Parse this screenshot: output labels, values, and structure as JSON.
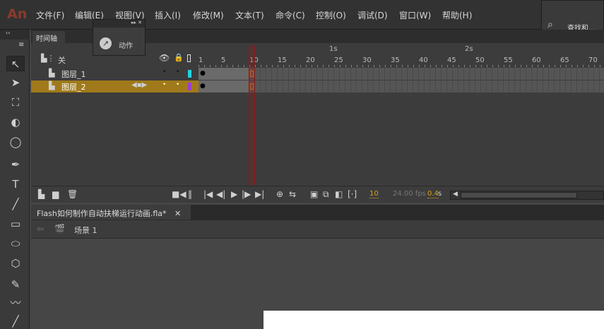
{
  "app": {
    "logo": "An"
  },
  "menu": [
    "文件(F)",
    "编辑(E)",
    "视图(V)",
    "插入(I)",
    "修改(M)",
    "文本(T)",
    "命令(C)",
    "控制(O)",
    "调试(D)",
    "窗口(W)",
    "帮助(H)"
  ],
  "right_panel": {
    "label": "查找和..."
  },
  "actions_panel": {
    "label": "动作"
  },
  "timeline": {
    "tab": "时间轴",
    "header_label": "关",
    "layers": [
      {
        "name": "图层_1",
        "color": "#22d3e0",
        "selected": false
      },
      {
        "name": "图层_2",
        "color": "#9b3fd0",
        "selected": true
      }
    ],
    "ruler_numbers": [
      "1",
      "5",
      "10",
      "15",
      "20",
      "25",
      "30",
      "35",
      "40",
      "45",
      "50",
      "55",
      "60",
      "65",
      "70"
    ],
    "seconds": [
      "1s",
      "2s"
    ],
    "current_frame": "10",
    "fps": "24.00 fps",
    "time": "0.4",
    "time_unit": "s"
  },
  "document": {
    "tab": "Flash如何制作自动扶梯运行动画.fla*",
    "scene": "场景 1"
  }
}
